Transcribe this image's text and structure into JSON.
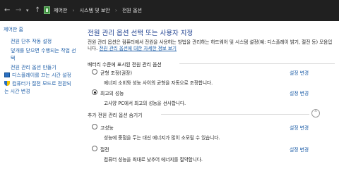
{
  "address_bar": {
    "back_icon": "←",
    "forward_icon": "→",
    "dropdown_icon": "▾",
    "up_icon": "↑",
    "breadcrumbs": [
      "제어판",
      "시스템 및 보안",
      "전원 옵션"
    ],
    "separator": "›"
  },
  "sidebar": {
    "home": "제어판 홈",
    "links": [
      "전원 단추 작동 설정",
      "덮개를 닫으면 수행되는 작업 선택",
      "전원 관리 옵션 만들기"
    ],
    "icon_links": [
      {
        "icon": "monitor-icon",
        "label": "디스플레이를 끄는 시간 설정"
      },
      {
        "icon": "shield-icon",
        "label": "컴퓨터가 절전 모드로 전환되는 시간 변경"
      }
    ]
  },
  "main": {
    "title": "전원 관리 옵션 선택 또는 사용자 지정",
    "description": "전원 관리 옵션은 컴퓨터에서 전원을 사용하는 방법을 관리하는 하드웨어 및 시스템 설정(예: 디스플레이 밝기, 절전 등) 모음입니다.",
    "description_link": "전원 관리 옵션에 대한 자세한 정보 보기",
    "battery_group": "배터리 수준에 표시된 전원 관리 옵션",
    "hidden_group": "추가 전원 관리 옵션 숨기기",
    "collapse_icon": "⌃",
    "plans": [
      {
        "name": "균형 조정(권장)",
        "desc": "에너지 소비와 성능 사이의 균형을 자동으로 조정합니다.",
        "selected": false,
        "link": "설정 변경"
      },
      {
        "name": "최고의 성능",
        "desc": "고사양 PC에서 최고의 성능을 선사합니다.",
        "selected": true,
        "link": "설정 변경"
      },
      {
        "name": "고성능",
        "desc": "성능에 중점을 두는 대신 에너지가 많이 소모될 수 있습니다.",
        "selected": false,
        "link": "설정 변경"
      },
      {
        "name": "절전",
        "desc": "컴퓨터 성능을 최대로 낮추어 에너지를 절약합니다.",
        "selected": false,
        "link": "설정 변경"
      }
    ]
  }
}
